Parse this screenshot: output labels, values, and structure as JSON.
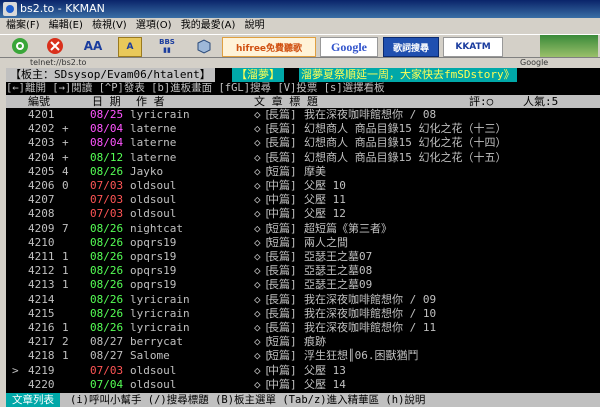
{
  "window": {
    "title": "bs2.to - KKMAN"
  },
  "menu": [
    "檔案(F)",
    "編輯(E)",
    "檢視(V)",
    "選項(O)",
    "我的最愛(A)",
    "說明"
  ],
  "toolbar": {
    "bbs_label": "BBS",
    "hifree_label": "hifree免費聽歌",
    "google_label": "Google",
    "song_search_label": "歌詞搜尋",
    "kkatm_label": "KKATM"
  },
  "address": {
    "url": "telnet://bs2.to",
    "google_label": "Google"
  },
  "terminal": {
    "board_label": "【板主：SDsysop/Evam06/htalent】",
    "board_title": "【溜夢】",
    "marquee": "溜夢夏祭順延一周，大家快去fmSDstory》",
    "help_line": "[←]離開 [→]閱讀 [^P]發表 [b]進板畫面 [fGL]搜尋 [V]投票 [s]選擇看板",
    "columns": {
      "num": "編號",
      "date": "日 期",
      "author": "作 者",
      "title": "文 章 標 題",
      "rating": "評:○",
      "pop": "人氣:5"
    },
    "rows": [
      {
        "num": "4201",
        "mark": "",
        "date": "08/25",
        "author": "lyricrain",
        "cat": "長篇",
        "title": "我在深夜咖啡館想你 / 08",
        "date_color": "#ff55ff"
      },
      {
        "num": "4202",
        "mark": "+",
        "date": "08/04",
        "author": "laterne",
        "cat": "長篇",
        "title": "幻想商人 商品目錄15 幻化之花（十三）",
        "date_color": "#ff55ff"
      },
      {
        "num": "4203",
        "mark": "+",
        "date": "08/04",
        "author": "laterne",
        "cat": "長篇",
        "title": "幻想商人 商品目錄15 幻化之花（十四）",
        "date_color": "#ff55ff"
      },
      {
        "num": "4204",
        "mark": "+",
        "date": "08/12",
        "author": "laterne",
        "cat": "長篇",
        "title": "幻想商人 商品目錄15 幻化之花（十五）",
        "date_color": "#55ff55"
      },
      {
        "num": "4205",
        "mark": "4",
        "date": "08/26",
        "author": "Jayko",
        "cat": "短篇",
        "title": "摩美",
        "date_color": "#55ff55"
      },
      {
        "num": "4206",
        "mark": "0",
        "date": "07/03",
        "author": "oldsoul",
        "cat": "中篇",
        "title": "父壓 10",
        "date_color": "#ff5555"
      },
      {
        "num": "4207",
        "mark": "",
        "date": "07/03",
        "author": "oldsoul",
        "cat": "中篇",
        "title": "父壓 11",
        "date_color": "#ff5555"
      },
      {
        "num": "4208",
        "mark": "",
        "date": "07/03",
        "author": "oldsoul",
        "cat": "中篇",
        "title": "父壓 12",
        "date_color": "#ff5555"
      },
      {
        "num": "4209",
        "mark": "7",
        "date": "08/26",
        "author": "nightcat",
        "cat": "短篇",
        "title": "超短篇《第三者》",
        "date_color": "#55ff55"
      },
      {
        "num": "4210",
        "mark": "",
        "date": "08/26",
        "author": "opqrs19",
        "cat": "短篇",
        "title": "兩人之間",
        "date_color": "#55ff55"
      },
      {
        "num": "4211",
        "mark": "1",
        "date": "08/26",
        "author": "opqrs19",
        "cat": "長篇",
        "title": "亞瑟王之墓07",
        "date_color": "#55ff55"
      },
      {
        "num": "4212",
        "mark": "1",
        "date": "08/26",
        "author": "opqrs19",
        "cat": "長篇",
        "title": "亞瑟王之墓08",
        "date_color": "#55ff55"
      },
      {
        "num": "4213",
        "mark": "1",
        "date": "08/26",
        "author": "opqrs19",
        "cat": "長篇",
        "title": "亞瑟王之墓09",
        "date_color": "#55ff55"
      },
      {
        "num": "4214",
        "mark": "",
        "date": "08/26",
        "author": "lyricrain",
        "cat": "長篇",
        "title": "我在深夜咖啡館想你 / 09",
        "date_color": "#55ff55"
      },
      {
        "num": "4215",
        "mark": "",
        "date": "08/26",
        "author": "lyricrain",
        "cat": "長篇",
        "title": "我在深夜咖啡館想你 / 10",
        "date_color": "#55ff55"
      },
      {
        "num": "4216",
        "mark": "1",
        "date": "08/26",
        "author": "lyricrain",
        "cat": "長篇",
        "title": "我在深夜咖啡館想你 / 11",
        "date_color": "#55ff55"
      },
      {
        "num": "4217",
        "mark": "2",
        "date": "08/27",
        "author": "berrycat",
        "cat": "短篇",
        "title": "痕跡",
        "date_color": "#c0c0c0"
      },
      {
        "num": "4218",
        "mark": "1",
        "date": "08/27",
        "author": "Salome",
        "cat": "短篇",
        "title": "浮生狂想║06.困獸猶鬥",
        "date_color": "#c0c0c0"
      },
      {
        "num": "4219",
        "mark": "",
        "date": "07/03",
        "author": "oldsoul",
        "cat": "中篇",
        "title": "父壓 13",
        "date_color": "#ff5555"
      },
      {
        "num": "4220",
        "mark": "",
        "date": "07/04",
        "author": "oldsoul",
        "cat": "中篇",
        "title": "父壓 14",
        "date_color": "#55ff55"
      }
    ],
    "cursor": ">",
    "footer_tag": "文章列表",
    "footer_help": "(i)呼叫小幫手 (/)搜尋標題 (B)板主選單 (Tab/z)進入精華區 (h)說明"
  }
}
